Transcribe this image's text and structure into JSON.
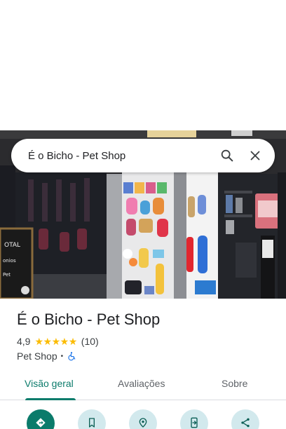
{
  "search": {
    "query": "É o Bicho - Pet Shop"
  },
  "place": {
    "title": "É o Bicho - Pet Shop",
    "rating": "4,9",
    "stars": 5,
    "review_count": "(10)",
    "category": "Pet Shop",
    "separator": "•"
  },
  "tabs": [
    {
      "label": "Visão geral",
      "active": true
    },
    {
      "label": "Avaliações",
      "active": false
    },
    {
      "label": "Sobre",
      "active": false
    }
  ],
  "actions": [
    {
      "icon": "directions-icon"
    },
    {
      "icon": "bookmark-icon"
    },
    {
      "icon": "nearby-icon"
    },
    {
      "icon": "send-to-phone-icon"
    },
    {
      "icon": "share-icon"
    }
  ],
  "colors": {
    "accent": "#0b7b6b",
    "action_bg": "#d2e9ed",
    "star": "#fbbc04"
  }
}
